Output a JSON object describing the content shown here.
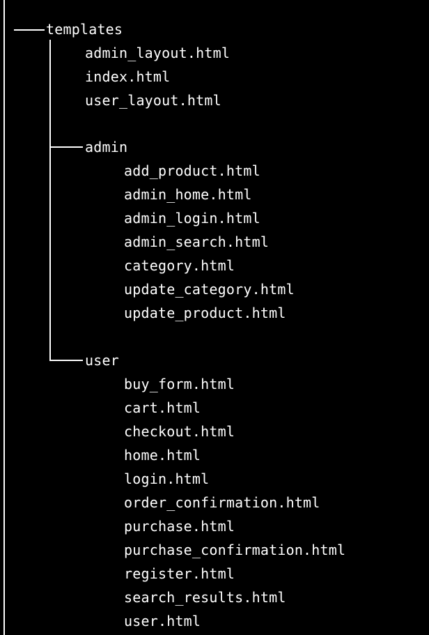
{
  "tree": {
    "root": {
      "label": "templates",
      "files": [
        "admin_layout.html",
        "index.html",
        "user_layout.html"
      ],
      "folders": [
        {
          "label": "admin",
          "files": [
            "add_product.html",
            "admin_home.html",
            "admin_login.html",
            "admin_search.html",
            "category.html",
            "update_category.html",
            "update_product.html"
          ]
        },
        {
          "label": "user",
          "files": [
            "buy_form.html",
            "cart.html",
            "checkout.html",
            "home.html",
            "login.html",
            "order_confirmation.html",
            "purchase.html",
            "purchase_confirmation.html",
            "register.html",
            "search_results.html",
            "user.html"
          ]
        }
      ]
    }
  },
  "colors": {
    "background": "#000000",
    "text": "#ffffff"
  }
}
